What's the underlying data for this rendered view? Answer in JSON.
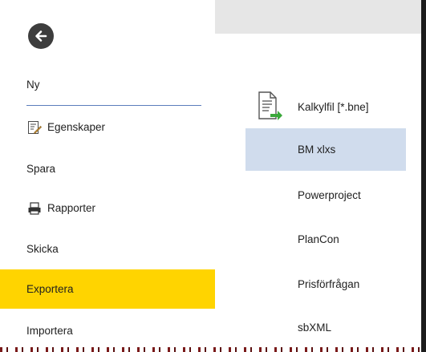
{
  "backstage": {
    "back_icon": "arrow-left-icon",
    "menu": [
      {
        "label": "Ny",
        "icon": null,
        "active": false
      },
      {
        "label": "Egenskaper",
        "icon": "properties-icon",
        "active": false
      },
      {
        "label": "Spara",
        "icon": null,
        "active": false
      },
      {
        "label": "Rapporter",
        "icon": "printer-icon",
        "active": false
      },
      {
        "label": "Skicka",
        "icon": null,
        "active": false
      },
      {
        "label": "Exportera",
        "icon": null,
        "active": true
      },
      {
        "label": "Importera",
        "icon": null,
        "active": false
      }
    ],
    "active_color": "#ffd400"
  },
  "export_options": [
    {
      "label": "Kalkylfil [*.bne]",
      "icon": "file-export-icon",
      "selected": false
    },
    {
      "label": "BM xlxs",
      "icon": null,
      "selected": true
    },
    {
      "label": "Powerproject",
      "icon": null,
      "selected": false
    },
    {
      "label": "PlanCon",
      "icon": null,
      "selected": false
    },
    {
      "label": "Prisförfrågan",
      "icon": null,
      "selected": false
    },
    {
      "label": "sbXML",
      "icon": null,
      "selected": false
    }
  ],
  "colors": {
    "selected_bg": "#d0dced",
    "divider": "#5b7dbb",
    "header_strip": "#e6e6e6"
  }
}
